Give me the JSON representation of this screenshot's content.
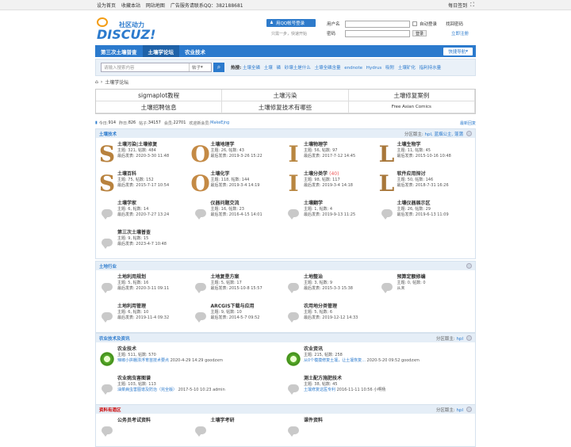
{
  "topbar": {
    "left": [
      "设为首页",
      "收藏本站",
      "网站地图",
      "广告服务请联系QQ：382188681"
    ],
    "right": "每日签到"
  },
  "logo": {
    "cn": "社区动力",
    "en": "DISCUZ!"
  },
  "qq": {
    "button": "用QQ帐号登录",
    "sub": "只需一步，快速开始"
  },
  "login": {
    "user_label": "用户名",
    "pass_label": "密码",
    "autologin": "自动登录",
    "forgot": "找回密码",
    "login_btn": "登录",
    "register": "立即注册"
  },
  "nav": {
    "items": [
      "第三次土壤普查",
      "土壤学论坛",
      "农业技术"
    ],
    "quick": "快捷导航"
  },
  "search": {
    "placeholder": "请输入搜索内容",
    "type": "帖子",
    "hot_label": "热搜:",
    "hot": [
      "土壤全磷",
      "土壤",
      "磷",
      "砂壤土是什么",
      "土壤全磷含量",
      "endnote",
      "Hydrus",
      "吸附",
      "土壤矿化",
      "指利持水量"
    ]
  },
  "crumb": {
    "title": "土壤学论坛"
  },
  "links": [
    "sigmaplot教程",
    "土壤污染",
    "土壤修复案例",
    "土壤招聘信息",
    "土壤修复技术有哪些",
    "Free Asian Comics"
  ],
  "stats": {
    "today_l": "今日:",
    "today": "914",
    "yest_l": "昨日:",
    "yest": "826",
    "posts_l": "帖子:",
    "posts": "34157",
    "members_l": "会员:",
    "members": "22701",
    "welcome": "欢迎新会员:",
    "newm": "MakeEjng",
    "latest": "最新回复"
  },
  "sections": [
    {
      "title": "土壤技术",
      "mod_l": "分区版主:",
      "mod": "hpl, 蓝烟公主, 蓬蒲",
      "forums": [
        {
          "name": "土壤污染|土壤修复",
          "icon": "S",
          "topics": "主题: 321, 帖数: 484",
          "last": "最后发表: 2020-3-30 11:48"
        },
        {
          "name": "土壤地理学",
          "icon": "O",
          "topics": "主题: 26, 帖数: 43",
          "last": "最后发表: 2019-3-26 15:22"
        },
        {
          "name": "土壤物理学",
          "icon": "I",
          "topics": "主题: 56, 帖数: 97",
          "last": "最后发表: 2017-7-12 14:45"
        },
        {
          "name": "土壤生物学",
          "icon": "L",
          "topics": "主题: 11, 帖数: 45",
          "last": "最后发表: 2015-10-16 10:48"
        },
        {
          "name": "土壤百科",
          "icon": "S",
          "topics": "主题: 75, 帖数: 152",
          "last": "最后发表: 2015-7-17 10:54"
        },
        {
          "name": "土壤化学",
          "icon": "O",
          "topics": "主题: 118, 帖数: 144",
          "last": "最后发表: 2019-3-4 14:19"
        },
        {
          "name": "土壤分类学",
          "badge": "(40)",
          "icon": "I",
          "topics": "主题: 98, 帖数: 117",
          "last": "最后发表: 2019-3-4 14:18"
        },
        {
          "name": "软件应用探讨",
          "icon": "L",
          "topics": "主题: 50, 帖数: 146",
          "last": "最后发表: 2018-7-31 16:26"
        },
        {
          "name": "土壤学家",
          "icon": "b",
          "topics": "主题: 6, 帖数: 14",
          "last": "最后发表: 2020-7-27 13:24"
        },
        {
          "name": "仪器问题交流",
          "icon": "b",
          "topics": "主题: 16, 帖数: 23",
          "last": "最后发表: 2016-4-15 14:01"
        },
        {
          "name": "土壤翻学",
          "icon": "b",
          "topics": "主题: 1, 帖数: 4",
          "last": "最后发表: 2019-9-13 11:25"
        },
        {
          "name": "土壤仪器展示区",
          "icon": "b",
          "topics": "主题: 26, 帖数: 29",
          "last": "最后发表: 2019-6-13 11:09"
        },
        {
          "name": "第三次土壤普查",
          "icon": "b",
          "topics": "主题: 9, 帖数: 15",
          "last": "最后发表: 2023-4-7 10:48"
        }
      ]
    },
    {
      "title": "土地行业",
      "forums": [
        {
          "name": "土地利用规划",
          "icon": "b",
          "topics": "主题: 5, 帖数: 16",
          "last": "最后发表: 2020-3-11 09:11"
        },
        {
          "name": "土地复垦方案",
          "icon": "b",
          "topics": "主题: 5, 帖数: 17",
          "last": "最后发表: 2015-10-8 15:57"
        },
        {
          "name": "土地整治",
          "icon": "b",
          "topics": "主题: 3, 帖数: 9",
          "last": "最后发表: 2015-3-3 15:38"
        },
        {
          "name": "预算定额修编",
          "icon": "b",
          "topics": "主题: 0, 帖数: 0",
          "last": "从未"
        },
        {
          "name": "土地利用管理",
          "icon": "b",
          "topics": "主题: 6, 帖数: 10",
          "last": "最后发表: 2019-11-4 09:32"
        },
        {
          "name": "ARCGIS下载与应用",
          "icon": "b",
          "topics": "主题: 9, 帖数: 10",
          "last": "最后发表: 2014-5-7 09:52"
        },
        {
          "name": "农用地分类管理",
          "icon": "b",
          "topics": "主题: 5, 帖数: 6",
          "last": "最后发表: 2019-12-12 14:33"
        }
      ]
    },
    {
      "title": "农业技术及资讯",
      "mod_l": "分区版主:",
      "mod": "hpl",
      "forums": [
        {
          "name": "农业技术",
          "icon": "r",
          "topics": "主题: 511, 帖数: 570",
          "lastlink": "辣椒小拱棚漂浮育苗技术要点",
          "lasttime": "2020-4-29 14:29 goodzxm"
        },
        {
          "name": "农业资讯",
          "icon": "r",
          "topics": "主题: 215, 帖数: 258",
          "lastlink": "从0个模摸修复土壤，让土壤恢复...",
          "lasttime": "2020-5-20 09:52 goodzxm"
        },
        {
          "name": "农业病虫害图谱",
          "icon": "b",
          "topics": "主题: 103, 帖数: 113",
          "lastlink": "油菜病虫害图谱及防治（完全版）",
          "lasttime": "2017-5-10 10:23 admin"
        },
        {
          "name": "测土配方施肥技术",
          "icon": "b",
          "topics": "主题: 38, 帖数: 45",
          "lastlink": "土壤修复这医专利",
          "lasttime": "2016-11-11 10:56 小啊杨"
        }
      ]
    },
    {
      "title": "资料有遗区",
      "mod_l": "分区版主:",
      "mod": "hpl",
      "forums": [
        {
          "name": "公务员考试资料",
          "icon": "b"
        },
        {
          "name": "土壤学考研",
          "icon": "b"
        },
        {
          "name": "课件资料",
          "icon": "b"
        }
      ]
    }
  ],
  "colors": {
    "brand": "#2b7acd"
  }
}
